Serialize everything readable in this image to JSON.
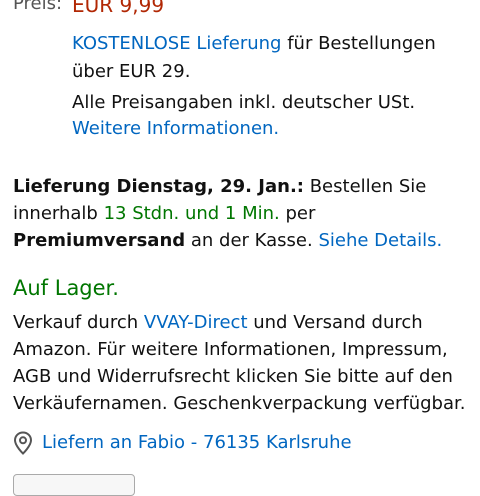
{
  "price": {
    "label": "Preis:",
    "value": "EUR 9,99"
  },
  "shipping": {
    "free_link": "KOSTENLOSE Lieferung",
    "free_rest": " für Bestellungen",
    "free_line2": "über EUR 29.",
    "vat_note": "Alle Preisangaben inkl. deutscher USt.",
    "more_info_link": "Weitere Informationen."
  },
  "delivery": {
    "date_bold": "Lieferung Dienstag, 29. Jan.:",
    "order_text": " Bestellen Sie",
    "within": "innerhalb ",
    "countdown": "13 Stdn. und 1 Min.",
    "per": " per",
    "premium_bold": "Premiumversand",
    "checkout_text": " an der Kasse. ",
    "details_link": "Siehe Details."
  },
  "availability": {
    "status": "Auf Lager."
  },
  "seller": {
    "line1_prefix": "Verkauf durch ",
    "seller_link": "VVAY-Direct",
    "line1_suffix": " und Versand durch",
    "line2": "Amazon. Für weitere Informationen, Impressum,",
    "line3": "AGB und Widerrufsrecht klicken Sie bitte auf den",
    "line4": "Verkäufernamen. Geschenkverpackung verfügbar."
  },
  "location": {
    "icon": "location-pin-icon",
    "text": "Liefern an Fabio - 76135 Karlsruhe"
  },
  "colors": {
    "price": "#B12704",
    "link": "#0066c0",
    "in_stock": "#007600"
  }
}
